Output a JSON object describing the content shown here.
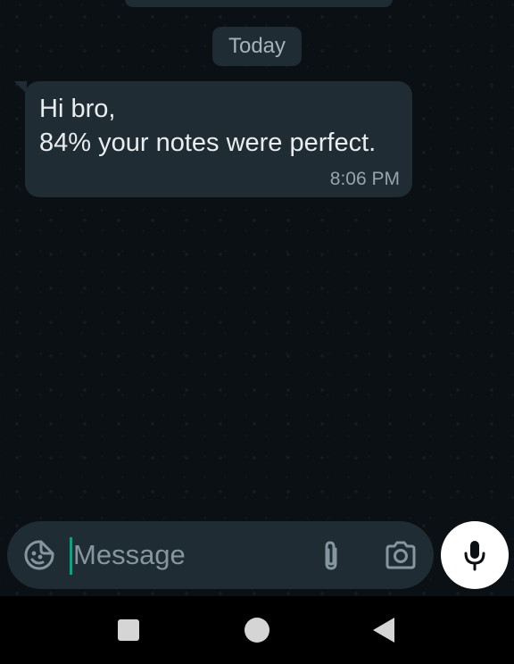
{
  "chat": {
    "date_divider": "Today",
    "messages": [
      {
        "direction": "incoming",
        "lines": [
          "Hi bro,",
          "84% your notes were perfect."
        ],
        "time": "8:06 PM"
      }
    ]
  },
  "composer": {
    "placeholder": "Message",
    "value": "",
    "icons": [
      "sticker-icon",
      "paperclip-icon",
      "camera-icon",
      "microphone-icon"
    ]
  },
  "navigation": {
    "buttons": [
      "recents-button",
      "home-button",
      "back-button"
    ]
  },
  "colors": {
    "background": "#0b1014",
    "bubble": "#1f2c34",
    "text": "#e9edef",
    "muted_text": "#8696a0",
    "caret_accent": "#00a884",
    "mic_button": "#ffffff"
  }
}
